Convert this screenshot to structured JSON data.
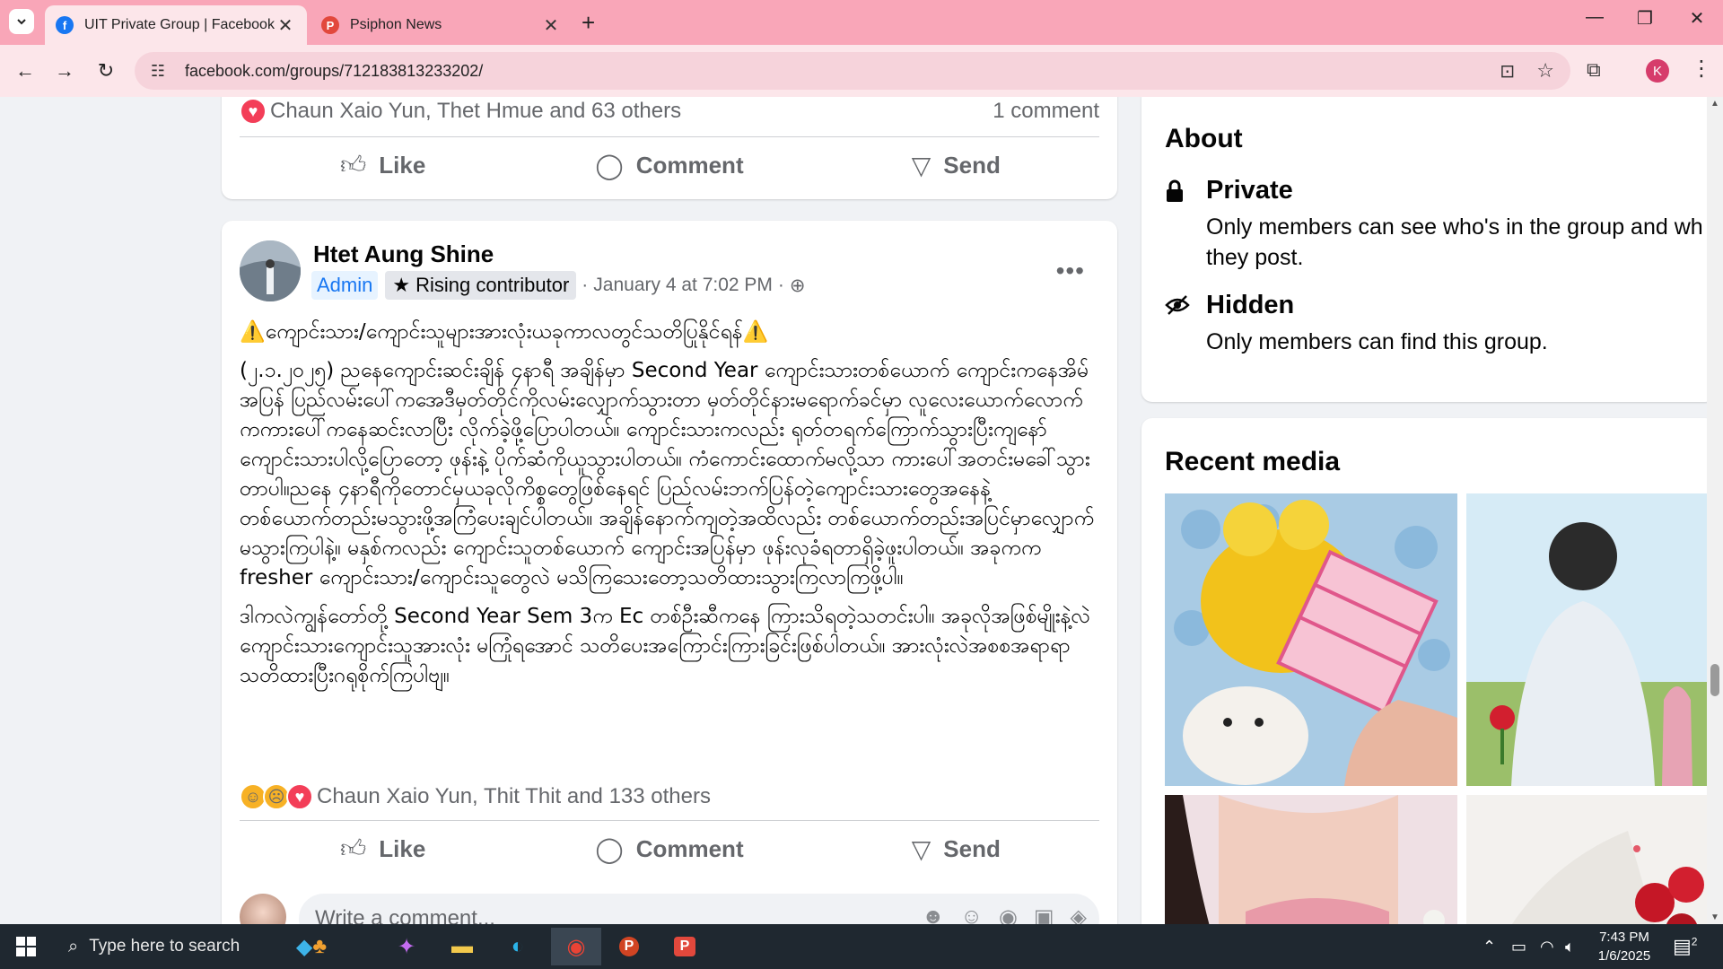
{
  "browser": {
    "tabs": [
      {
        "title": "UIT Private Group | Facebook",
        "active": true,
        "favicon": "facebook-icon"
      },
      {
        "title": "Psiphon News",
        "active": false,
        "favicon": "psiphon-icon"
      }
    ],
    "url": "facebook.com/groups/712183813233202/",
    "profile_initial": "K"
  },
  "previous_post": {
    "reactions_text": "Chaun Xaio Yun, Thet Hmue and 63 others",
    "comments_text": "1 comment",
    "actions": {
      "like": "Like",
      "comment": "Comment",
      "send": "Send"
    }
  },
  "post": {
    "author": "Htet Aung Shine",
    "badges": {
      "admin": "Admin",
      "rising": "Rising contributor"
    },
    "timestamp": "January 4 at 7:02 PM",
    "title": "⚠️ကျောင်းသား/ကျောင်းသူများအားလုံးယခုကာလတွင်သတိပြုနိုင်ရန်⚠️",
    "paragraph1": "(၂.၁.၂၀၂၅) ညနေကျောင်းဆင်းချိန် ၄နာရီ အချိန်မှာ Second Year ကျောင်းသားတစ်ယောက် ကျောင်းကနေအိမ်အပြန် ပြည်လမ်းပေါ်ကအေဒီမှတ်တိုင်ကိုလမ်းလျှောက်သွားတာ မှတ်တိုင်နားမရောက်ခင်မှာ လူလေးယောက်လောက်ကကားပေါ်ကနေဆင်းလာပြီး လိုက်ခဲ့ဖို့ပြောပါတယ်။ ကျောင်းသားကလည်း ရုတ်တရက်ကြောက်သွားပြီးကျနော်ကျောင်းသားပါလို့ပြောတော့ ဖုန်းနဲ့ ပိုက်ဆံကိုယူသွားပါတယ်။ ကံကောင်းထောက်မလို့သာ ကားပေါ်အတင်းမခေါ်သွားတာပါ။ညနေ ၄နာရီကိုတောင်မှယခုလိုကိစ္စတွေဖြစ်နေရင် ပြည်လမ်းဘက်ပြန်တဲ့ကျောင်းသားတွေအနေနဲ့ တစ်ယောက်တည်းမသွားဖို့အကြံပေးချင်ပါတယ်။ အချိန်နောက်ကျတဲ့အထိလည်း တစ်ယောက်တည်းအပြင်မှာလျှောက်မသွားကြပါနဲ့။ မနှစ်ကလည်း ကျောင်းသူတစ်ယောက် ကျောင်းအပြန်မှာ ဖုန်းလုခံရတာရှိခဲ့ဖူးပါတယ်။ အခုကက fresher ကျောင်းသား/ကျောင်းသူတွေလဲ မသိကြသေးတော့သတိထားသွားကြလာကြဖို့ပါ။",
    "paragraph2": "ဒါကလဲကျွန်တော်တို့ Second Year Sem 3က Ec တစ်ဦးဆီကနေ ကြားသိရတဲ့သတင်းပါ။ အခုလိုအဖြစ်မျိုးနဲ့လဲ ကျောင်းသားကျောင်းသူအားလုံး မကြုံရအောင် သတိပေးအကြောင်းကြားခြင်းဖြစ်ပါတယ်။ အားလုံးလဲအစစအရာရာသတိထားပြီးဂရုစိုက်ကြပါဗျ။",
    "reactions_text": "Chaun Xaio Yun, Thit Thit and 133 others",
    "actions": {
      "like": "Like",
      "comment": "Comment",
      "send": "Send"
    },
    "comment_placeholder": "Write a comment..."
  },
  "sidebar": {
    "about_title": "About",
    "private_title": "Private",
    "private_desc1": "Only members can see who's in the group and wh",
    "private_desc2": "they post.",
    "hidden_title": "Hidden",
    "hidden_desc": "Only members can find this group.",
    "recent_media_title": "Recent media"
  },
  "taskbar": {
    "search_placeholder": "Type here to search",
    "time": "7:43 PM",
    "date": "1/6/2025",
    "notification_count": "2"
  },
  "colors": {
    "tab_bar": "#f9a6b8",
    "toolbar": "#fce6ea",
    "facebook_blue": "#1877f2",
    "feed_bg": "#f0f2f5"
  }
}
